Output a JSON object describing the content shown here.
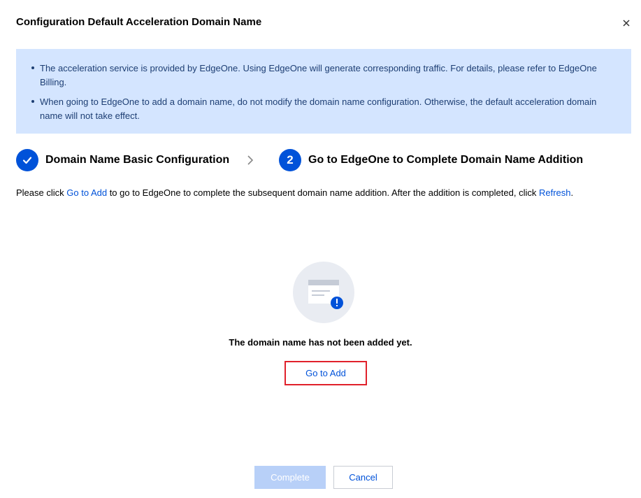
{
  "dialog": {
    "title": "Configuration Default Acceleration Domain Name",
    "close_icon": "close-icon"
  },
  "notice": {
    "items": [
      "The acceleration service is provided by EdgeOne. Using EdgeOne will generate corresponding traffic. For details, please refer to EdgeOne Billing.",
      "When going to EdgeOne to add a domain name, do not modify the domain name configuration. Otherwise, the default acceleration domain name will not take effect."
    ]
  },
  "steps": [
    {
      "label": "Domain Name Basic Configuration",
      "status": "completed",
      "icon": "check-icon"
    },
    {
      "label": "Go to EdgeOne to Complete Domain Name Addition",
      "status": "current",
      "number": "2"
    }
  ],
  "instruction": {
    "part1": "Please click ",
    "link1": "Go to Add",
    "part2": " to go to EdgeOne to complete the subsequent domain name addition. After the addition is completed, click ",
    "link2": "Refresh",
    "part3": "."
  },
  "empty_state": {
    "icon": "document-warning-icon",
    "message": "The domain name has not been added yet.",
    "action_label": "Go to Add"
  },
  "footer": {
    "complete_label": "Complete",
    "cancel_label": "Cancel"
  },
  "colors": {
    "primary": "#0052d9",
    "notice_bg": "#d4e5ff",
    "highlight_border": "#e0212b",
    "disabled_primary": "#b8d0f8"
  }
}
